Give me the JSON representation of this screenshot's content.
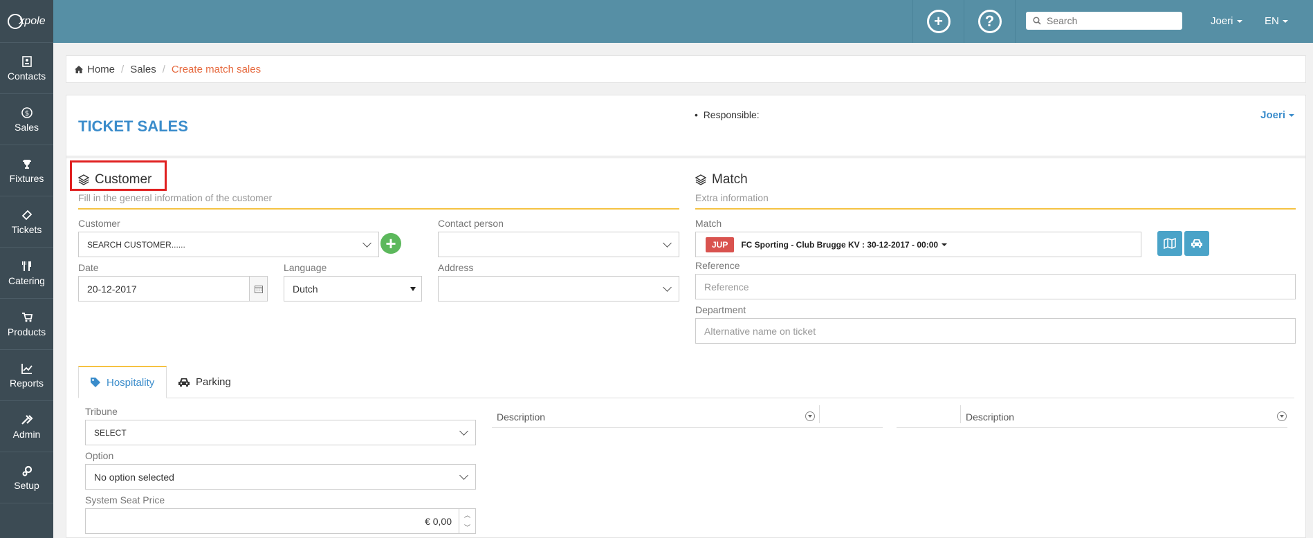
{
  "app": {
    "logo_text": "xpole"
  },
  "sidebar": {
    "items": [
      {
        "label": "Contacts",
        "icon": "contacts-icon"
      },
      {
        "label": "Sales",
        "icon": "dollar-icon"
      },
      {
        "label": "Fixtures",
        "icon": "trophy-icon"
      },
      {
        "label": "Tickets",
        "icon": "ticket-icon"
      },
      {
        "label": "Catering",
        "icon": "cutlery-icon"
      },
      {
        "label": "Products",
        "icon": "cart-icon"
      },
      {
        "label": "Reports",
        "icon": "chart-icon"
      },
      {
        "label": "Admin",
        "icon": "tools-icon"
      },
      {
        "label": "Setup",
        "icon": "gears-icon"
      }
    ]
  },
  "topbar": {
    "add_icon": "+",
    "help_icon": "?",
    "search_placeholder": "Search",
    "user": "Joeri",
    "language": "EN"
  },
  "breadcrumb": {
    "home": "Home",
    "sales": "Sales",
    "current": "Create match sales"
  },
  "page": {
    "title": "TICKET SALES",
    "responsible_label": "Responsible:",
    "responsible_user": "Joeri"
  },
  "customer_section": {
    "title": "Customer",
    "subtitle": "Fill in the general information of the customer",
    "customer_label": "Customer",
    "customer_value": "SEARCH CUSTOMER......",
    "contact_label": "Contact person",
    "date_label": "Date",
    "date_value": "20-12-2017",
    "language_label": "Language",
    "language_value": "Dutch",
    "address_label": "Address"
  },
  "match_section": {
    "title": "Match",
    "subtitle": "Extra information",
    "match_label": "Match",
    "match_badge": "JUP",
    "match_value": "FC Sporting - Club Brugge KV : 30-12-2017 - 00:00",
    "reference_label": "Reference",
    "reference_placeholder": "Reference",
    "department_label": "Department",
    "department_placeholder": "Alternative name on ticket"
  },
  "tabs": [
    {
      "label": "Hospitality"
    },
    {
      "label": "Parking"
    }
  ],
  "hospitality": {
    "tribune_label": "Tribune",
    "tribune_value": "SELECT",
    "option_label": "Option",
    "option_value": "No option selected",
    "seat_price_label": "System Seat Price",
    "seat_price_value": "€ 0,00",
    "col_description_1": "Description",
    "col_description_2": "Description"
  },
  "colors": {
    "accent": "#3a8ccb",
    "topbar": "#568fa5",
    "sidebar": "#3c4b54",
    "warning_line": "#f5c242",
    "breadcrumb_active": "#e6693e"
  }
}
